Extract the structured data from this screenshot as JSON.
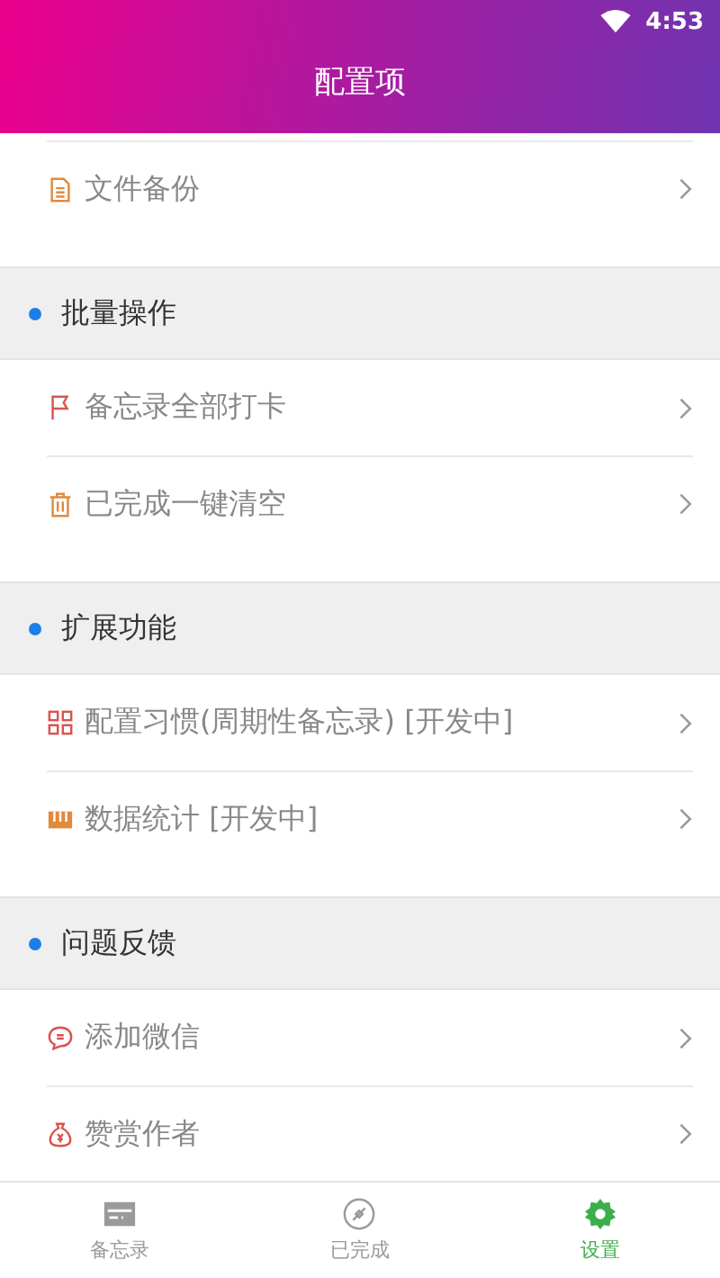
{
  "status_bar": {
    "time": "4:53"
  },
  "header": {
    "title": "配置项"
  },
  "groups": [
    {
      "items": [
        {
          "label": "文件备份"
        }
      ]
    },
    {
      "title": "批量操作",
      "items": [
        {
          "label": "备忘录全部打卡"
        },
        {
          "label": "已完成一键清空"
        }
      ]
    },
    {
      "title": "扩展功能",
      "items": [
        {
          "label": "配置习惯(周期性备忘录) [开发中]"
        },
        {
          "label": "数据统计 [开发中]"
        }
      ]
    },
    {
      "title": "问题反馈",
      "items": [
        {
          "label": "添加微信"
        },
        {
          "label": "赞赏作者"
        }
      ]
    }
  ],
  "tab_bar": [
    {
      "label": "备忘录",
      "selected": false
    },
    {
      "label": "已完成",
      "selected": false
    },
    {
      "label": "设置",
      "selected": true
    }
  ]
}
